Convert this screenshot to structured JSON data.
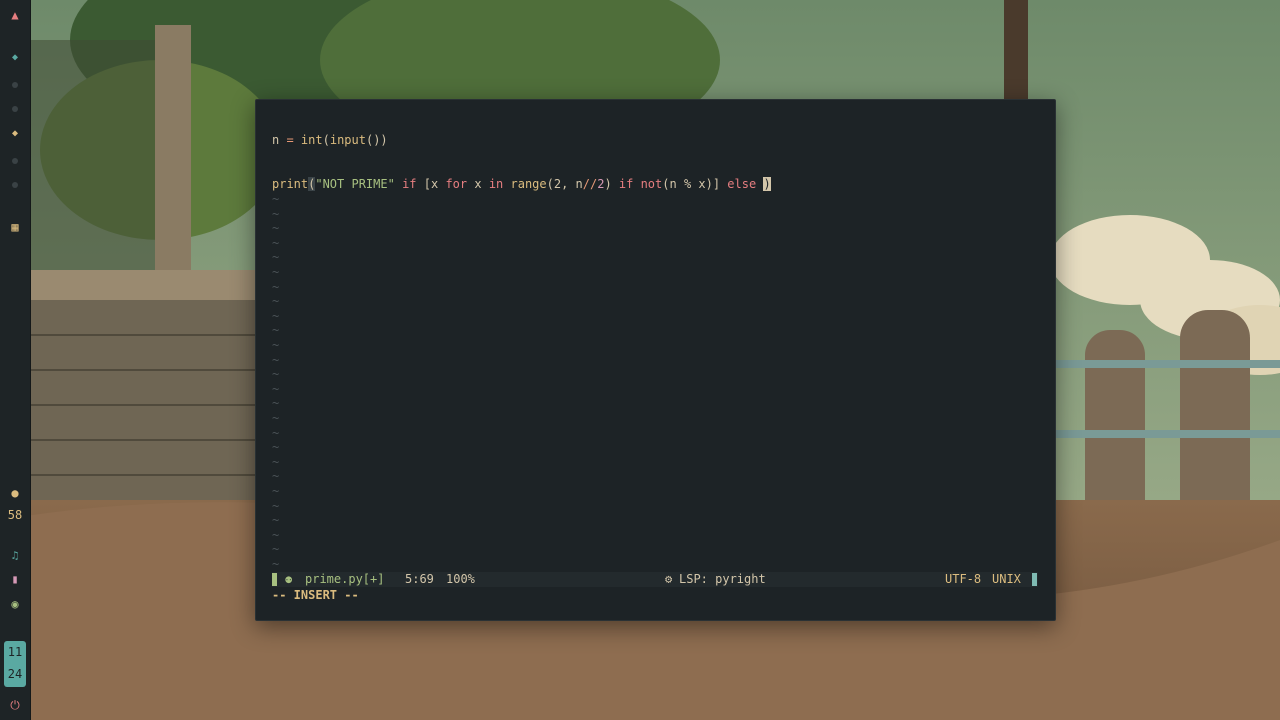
{
  "sidebar": {
    "battery_value": "58",
    "clock_hour": "11",
    "clock_minute": "24"
  },
  "editor": {
    "lines": {
      "l1": {
        "var": "n",
        "eq": " = ",
        "f1": "int",
        "p1": "(",
        "f2": "input",
        "p2": "())"
      },
      "l2": {
        "print": "print",
        "open": "(",
        "s": "\"NOT PRIME\"",
        "if1": " if ",
        "lb": "[x ",
        "for": "for",
        "x": " x ",
        "in": "in",
        "sp": " ",
        "range": "range",
        "args_a": "(2, n",
        "op": "//",
        "args_b": "2",
        "close_range": ") ",
        "if2": "if",
        "sp2": " ",
        "not": "not",
        "expr": "(n % x)] ",
        "else": "else",
        "sp3": " ",
        "cursor": ")"
      }
    },
    "tilde": "~"
  },
  "statusline": {
    "icon": "⚉",
    "filename": "prime.py[+]",
    "position": "5:69",
    "percent": "100%",
    "lsp_icon": "⚙",
    "lsp": "LSP: pyright",
    "encoding": "UTF-8",
    "format": "UNIX"
  },
  "mode": "-- INSERT --",
  "colors": {
    "accent_green": "#a7c080",
    "accent_yellow": "#dbbc7f",
    "accent_red": "#e67e80",
    "clock_bg": "#5aa9a2"
  }
}
